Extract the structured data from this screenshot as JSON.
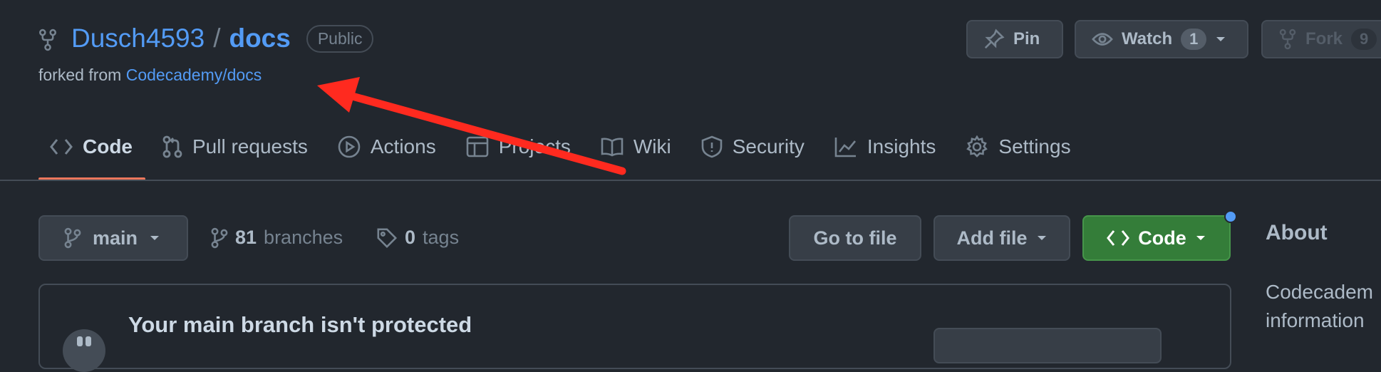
{
  "header": {
    "owner": "Dusch4593",
    "slash": "/",
    "repo": "docs",
    "visibility": "Public",
    "forked_prefix": "forked from",
    "forked_source": "Codecademy/docs",
    "pin_label": "Pin",
    "watch_label": "Watch",
    "watch_count": "1",
    "fork_label": "Fork",
    "fork_count": "9"
  },
  "tabs": [
    {
      "label": "Code",
      "icon": "code-icon",
      "active": true
    },
    {
      "label": "Pull requests",
      "icon": "git-pull-request-icon"
    },
    {
      "label": "Actions",
      "icon": "play-icon"
    },
    {
      "label": "Projects",
      "icon": "table-icon"
    },
    {
      "label": "Wiki",
      "icon": "book-icon"
    },
    {
      "label": "Security",
      "icon": "shield-icon"
    },
    {
      "label": "Insights",
      "icon": "graph-icon"
    },
    {
      "label": "Settings",
      "icon": "gear-icon"
    }
  ],
  "toolbar": {
    "branch": "main",
    "branches_count": "81",
    "branches_label": "branches",
    "tags_count": "0",
    "tags_label": "tags",
    "go_to_file": "Go to file",
    "add_file": "Add file",
    "code": "Code"
  },
  "about": {
    "title": "About",
    "description": "Codecadem\ninformation"
  },
  "banner": {
    "title": "Your main branch isn't protected"
  },
  "annotation": {
    "arrow_color": "#ff2a1f"
  },
  "colors": {
    "background": "#22272e",
    "link": "#539bf5",
    "primary_button": "#347d39",
    "active_tab_underline": "#ec775c"
  }
}
